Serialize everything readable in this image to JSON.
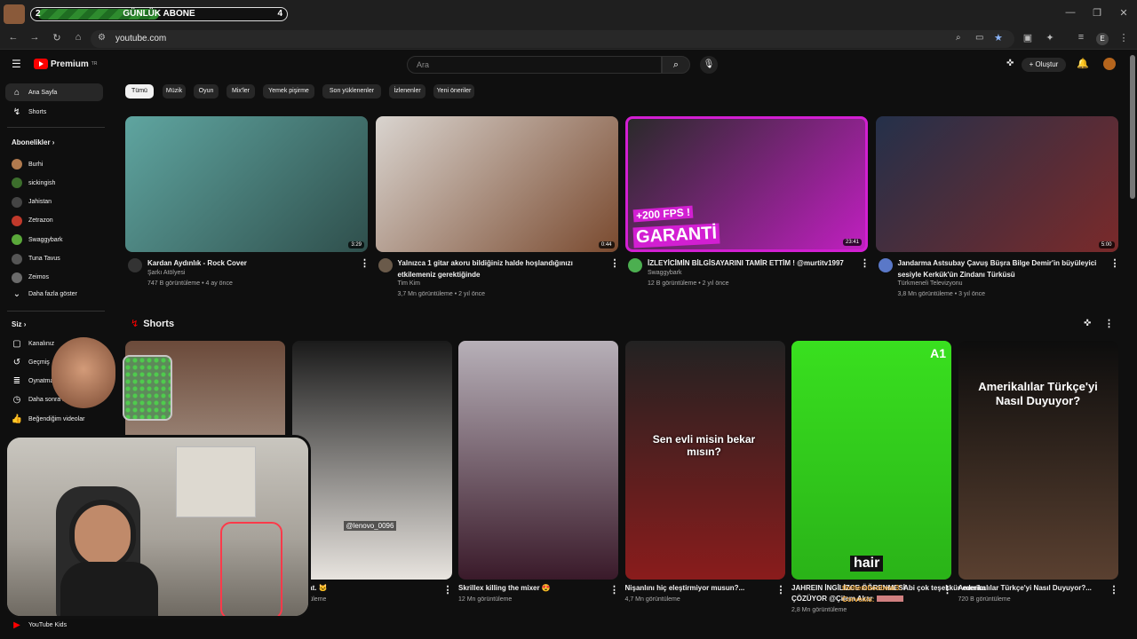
{
  "browser": {
    "subscriber_goal": {
      "label": "GÜNLÜK ABONE",
      "current": "2",
      "target": "4",
      "progress": 0.5
    },
    "url": "youtube.com",
    "profile_initial": "E"
  },
  "header": {
    "logo_text": "Premium",
    "logo_badge": "TR",
    "search_placeholder": "Ara",
    "create_label": "Oluştur"
  },
  "sidebar": {
    "main": [
      {
        "label": "Ana Sayfa",
        "icon": "home-icon",
        "active": true
      },
      {
        "label": "Shorts",
        "icon": "shorts-icon",
        "active": false
      }
    ],
    "subs_heading": "Abonelikler",
    "subs": [
      {
        "label": "Burhi",
        "color": "#b07a4e"
      },
      {
        "label": "sickingish",
        "color": "#3c6e2c"
      },
      {
        "label": "Jahistan",
        "color": "#444444"
      },
      {
        "label": "Zetrazon",
        "color": "#c0392b"
      },
      {
        "label": "Swaggybark",
        "color": "#5aa83a"
      },
      {
        "label": "Tuna Tavus",
        "color": "#555555"
      },
      {
        "label": "Zeimos",
        "color": "#6b6b6b"
      }
    ],
    "more_label": "Daha fazla göster",
    "you_heading": "Siz",
    "you_items": [
      {
        "label": "Kanalınız",
        "icon": "channel-icon"
      },
      {
        "label": "Geçmiş",
        "icon": "history-icon"
      },
      {
        "label": "Oynatma listeleri",
        "icon": "playlist-icon"
      },
      {
        "label": "Daha sonra izle",
        "icon": "watch-later-icon"
      },
      {
        "label": "Beğendiğim videolar",
        "icon": "like-icon"
      }
    ],
    "kids_label": "YouTube Kids"
  },
  "chips": [
    "Tümü",
    "Müzik",
    "Oyun",
    "Mix'ler",
    "Yemek pişirme",
    "Son yüklenenler",
    "İzlenenler",
    "Yeni öneriler"
  ],
  "videos": [
    {
      "title": "Kardan Aydınlık - Rock Cover",
      "channel": "Şarkı Atölyesi",
      "stats": "747 B görüntüleme • 4 ay önce",
      "duration": "3:29",
      "colors": [
        "#5fa5a0",
        "#2f4f4c"
      ]
    },
    {
      "title": "Yalnızca 1 gitar akoru bildiğiniz halde hoşlandığınızı etkilemeniz gerektiğinde",
      "channel": "Tim Kim",
      "stats": "3,7 Mn görüntüleme • 2 yıl önce",
      "duration": "0:44",
      "colors": [
        "#d9d4cf",
        "#7a4a2f"
      ]
    },
    {
      "title": "İZLEYİCİMİN BİLGİSAYARINI TAMİR ETTİM ! @murtitv1997",
      "channel": "Swaggybark",
      "stats": "12 B görüntüleme • 2 yıl önce",
      "duration": "23:41",
      "overlay_top": "+200 FPS !",
      "overlay_main": "GARANTİ",
      "colors": [
        "#2a2a2a",
        "#c01fc0"
      ]
    },
    {
      "title": "Jandarma Astsubay Çavuş Büşra Bilge Demir'in büyüleyici sesiyle Kerkük'ün Zindanı Türküsü",
      "channel": "Türkmeneli Televizyonu",
      "stats": "3,8 Mn görüntüleme • 3 yıl önce",
      "duration": "5:00",
      "colors": [
        "#24304a",
        "#7a2a2a"
      ]
    }
  ],
  "shorts_heading": "Shorts",
  "shorts": [
    {
      "title": "",
      "stats": "",
      "colors": [
        "#6b4a3a",
        "#d8cfc4"
      ]
    },
    {
      "title": "big cat. 🐱",
      "stats": "görüntüleme",
      "tag": "@lenovo_0096",
      "colors": [
        "#1a1a1a",
        "#e8e4df"
      ]
    },
    {
      "title": "Skrillex killing the mixer 😍",
      "stats": "12 Mn görüntüleme",
      "colors": [
        "#b7b0b8",
        "#3a1a2a"
      ]
    },
    {
      "title": "Nişanlını hiç eleştirmiyor musun?...",
      "stats": "4,7 Mn görüntüleme",
      "caption": "Sen evli misin bekar mısın?",
      "colors": [
        "#222222",
        "#8a1c1c"
      ]
    },
    {
      "title": "JAHREIN İNGİLİZCE ÖĞRENMESİ ÇÖZÜYOR @Çilem Akar",
      "stats": "2,8 Mn görüntüleme",
      "word": "hair",
      "corner": "A1",
      "colors": [
        "#39e01f",
        "#2ab318"
      ]
    },
    {
      "title": "Amerikalılar Türkçe'yi Nasıl Duyuyor?...",
      "stats": "720 B görüntüleme",
      "overlay": "Amerikalılar Türkçe'yi Nasıl Duyuyor?",
      "colors": [
        "#0d0d0d",
        "#5a4030"
      ]
    }
  ],
  "chat": [
    {
      "user": "thehemboobear3:",
      "msg": "Abi çok teşekkür ederim",
      "color": "#e8a33a"
    },
    {
      "user": "Corvexis:",
      "msg": "",
      "color": "#e8a33a"
    }
  ],
  "colors": {
    "bg": "#0f0f0f",
    "accent": "#ff0000"
  }
}
